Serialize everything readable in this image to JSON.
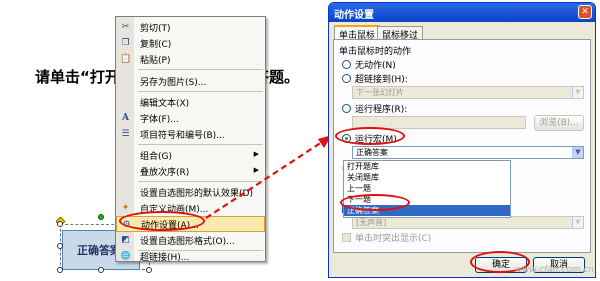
{
  "slide": {
    "text_left": "请单击“打开",
    "text_right": "答题。",
    "shape_label": "正确答案"
  },
  "context_menu": {
    "items": [
      {
        "label": "剪切(T)",
        "icon": "scissors-icon",
        "glyph": "✂"
      },
      {
        "label": "复制(C)",
        "icon": "copy-icon",
        "glyph": "❐"
      },
      {
        "label": "粘贴(P)",
        "icon": "paste-icon",
        "glyph": "📋"
      },
      {
        "label": "另存为图片(S)...",
        "icon": "",
        "glyph": ""
      },
      {
        "label": "编辑文本(X)",
        "icon": "",
        "glyph": ""
      },
      {
        "label": "字体(F)...",
        "icon": "font-icon",
        "glyph": "A"
      },
      {
        "label": "项目符号和编号(B)...",
        "icon": "bullets-icon",
        "glyph": "☰"
      },
      {
        "label": "组合(G)",
        "icon": "",
        "glyph": ""
      },
      {
        "label": "叠放次序(R)",
        "icon": "",
        "glyph": ""
      },
      {
        "label": "设置自选图形的默认效果(D)",
        "icon": "",
        "glyph": ""
      },
      {
        "label": "自定义动画(M)...",
        "icon": "animation-icon",
        "glyph": "✦"
      },
      {
        "label": "动作设置(A)...",
        "icon": "action-icon",
        "glyph": "⚙"
      },
      {
        "label": "设置自选图形格式(O)...",
        "icon": "format-icon",
        "glyph": "◩"
      },
      {
        "label": "超链接(H)...",
        "icon": "hyperlink-icon",
        "glyph": "🌐"
      }
    ]
  },
  "dialog": {
    "title": "动作设置",
    "close_glyph": "✕",
    "tabs": [
      "单击鼠标",
      "鼠标移过"
    ],
    "group_label": "单击鼠标时的动作",
    "radio_none": "无动作(N)",
    "radio_hyperlink": "超链接到(H):",
    "hyperlink_value": "下一张幻灯片",
    "radio_program": "运行程序(R):",
    "browse_button": "浏览(B)...",
    "radio_macro": "运行宏(M)",
    "macro_value": "正确答案",
    "macro_options": [
      "打开题库",
      "关闭题库",
      "上一题",
      "下一题",
      "正确答案"
    ],
    "sound_value": "[无声音]",
    "highlight_label": "单击时突出显示(C)",
    "ok_button": "确定",
    "cancel_button": "取消"
  },
  "watermark": "www.cfan.com.cn"
}
